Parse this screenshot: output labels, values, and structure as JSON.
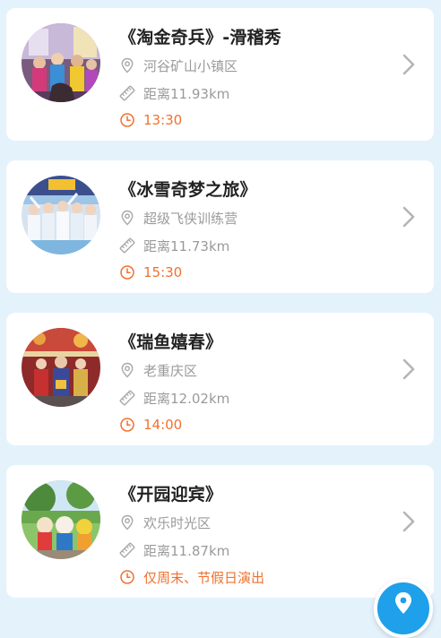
{
  "shows": [
    {
      "title": "《淘金奇兵》-滑稽秀",
      "location": "河谷矿山小镇区",
      "distance": "距离11.93km",
      "time": "13:30",
      "photo": "performers-group-photo"
    },
    {
      "title": "《冰雪奇梦之旅》",
      "location": "超级飞侠训练营",
      "distance": "距离11.73km",
      "time": "15:30",
      "photo": "ice-dancers-stage-photo"
    },
    {
      "title": "《瑞鱼嬉春》",
      "location": "老重庆区",
      "distance": "距离12.02km",
      "time": "14:00",
      "photo": "festival-costume-photo"
    },
    {
      "title": "《开园迎宾》",
      "location": "欢乐时光区",
      "distance": "距离11.87km",
      "time": "仅周末、节假日演出",
      "photo": "mascot-welcome-photo"
    }
  ],
  "icons": {
    "location": "location-pin-icon",
    "distance": "ruler-icon",
    "time": "clock-icon",
    "arrow": "chevron-right-icon",
    "fab": "map-location-icon"
  },
  "colors": {
    "background": "#e4f2fc",
    "card": "#ffffff",
    "title": "#222222",
    "secondary_text": "#9a9a9a",
    "time_accent": "#f0712f",
    "fab": "#1ea0ea"
  }
}
